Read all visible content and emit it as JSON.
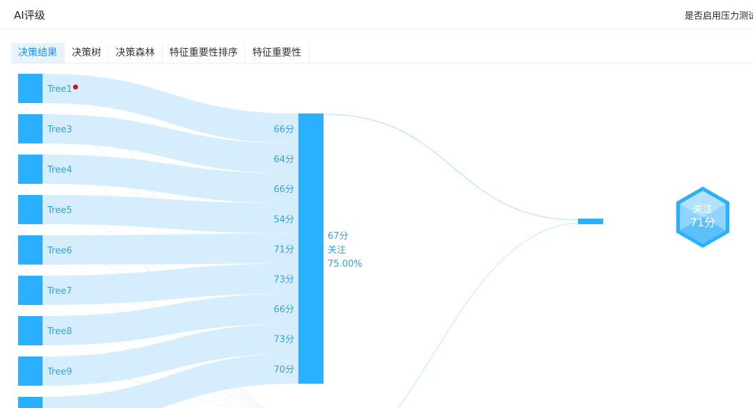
{
  "header": {
    "title": "AI评级",
    "stress_test_label": "是否启用压力测试"
  },
  "tabs": [
    {
      "label": "决策结果",
      "active": true
    },
    {
      "label": "决策树",
      "active": false
    },
    {
      "label": "决策森林",
      "active": false
    },
    {
      "label": "特征重要性排序",
      "active": false
    },
    {
      "label": "特征重要性",
      "active": false
    }
  ],
  "colors": {
    "node": "#2ab0ff",
    "link": "#cfeafd",
    "label": "#33a1e8",
    "marker": "#e60012"
  },
  "sankey": {
    "trees": [
      {
        "name": "Tree1",
        "marked": true
      },
      {
        "name": "Tree3"
      },
      {
        "name": "Tree4"
      },
      {
        "name": "Tree5"
      },
      {
        "name": "Tree6"
      },
      {
        "name": "Tree7"
      },
      {
        "name": "Tree8"
      },
      {
        "name": "Tree9"
      },
      {
        "name": ""
      }
    ],
    "scores": [
      "66分",
      "64分",
      "66分",
      "54分",
      "71分",
      "73分",
      "66分",
      "73分",
      "70分"
    ],
    "aggregate": {
      "score": "67分",
      "label": "关注",
      "percent": "75.00%"
    },
    "result_badge": {
      "label": "关注",
      "score": "71分"
    }
  }
}
